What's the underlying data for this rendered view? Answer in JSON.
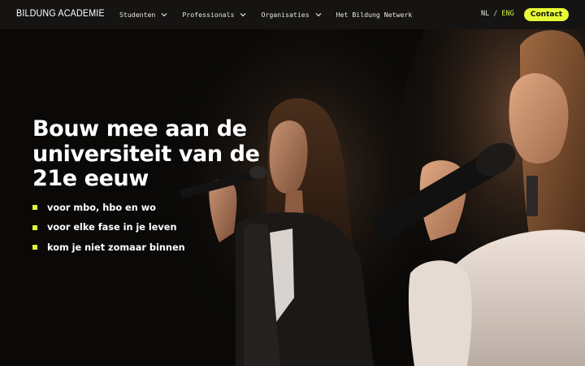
{
  "header": {
    "logo": "BILDUNG ACADEMIE",
    "menu": [
      {
        "label": "Studenten",
        "has_dropdown": true
      },
      {
        "label": "Professionals",
        "has_dropdown": true
      },
      {
        "label": "Organisaties",
        "has_dropdown": true
      },
      {
        "label": "Het Bildung Netwerk",
        "has_dropdown": false
      }
    ],
    "lang": {
      "nl": "NL",
      "separator": "/",
      "eng": "ENG",
      "active": "ENG"
    },
    "contact_label": "Contact"
  },
  "hero": {
    "headline": "Bouw mee aan de universiteit van de 21e eeuw",
    "bullets": [
      "voor mbo, hbo en wo",
      "voor elke fase in je leven",
      "kom je niet zomaar binnen"
    ]
  },
  "colors": {
    "accent": "#e8fb36",
    "nav_bg": "#151413",
    "page_bg": "#0a0908",
    "text": "#ffffff"
  },
  "icons": {
    "dropdown": "chevron-down-icon",
    "bullet": "square-bullet-icon"
  }
}
